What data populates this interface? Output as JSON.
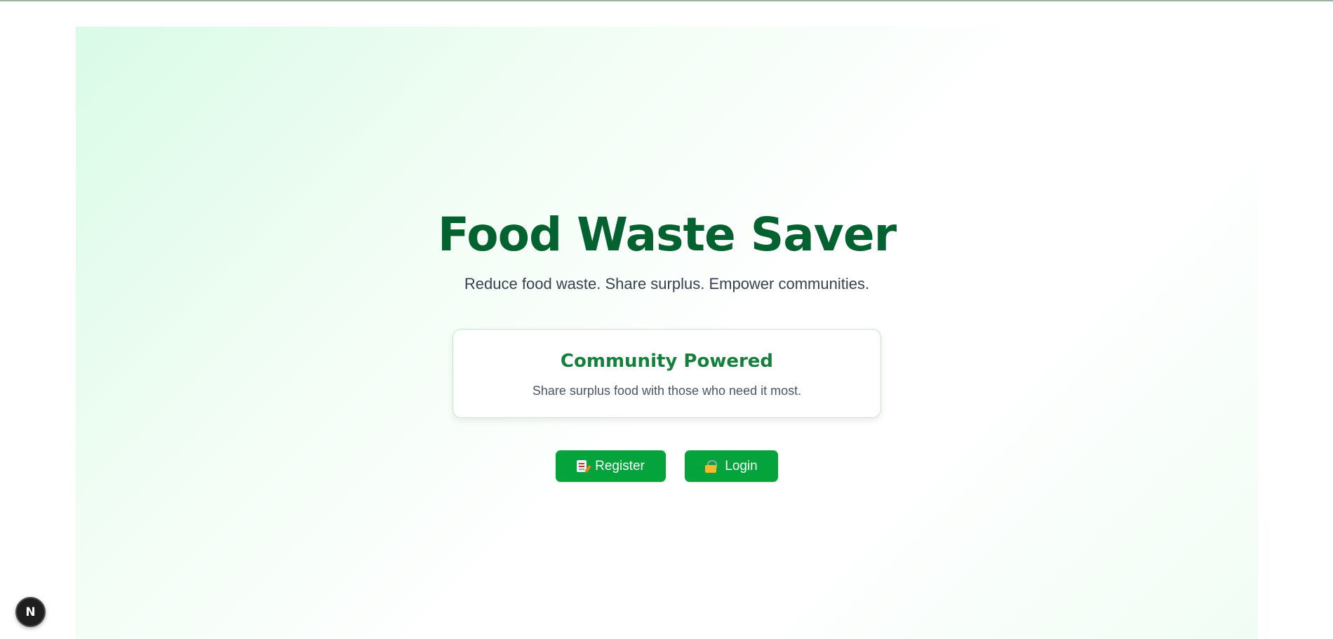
{
  "hero": {
    "title": "Food Waste Saver",
    "subtitle": "Reduce food waste. Share surplus. Empower communities."
  },
  "card": {
    "title": "Community Powered",
    "text": "Share surplus food with those who need it most."
  },
  "actions": {
    "register_label": "Register",
    "register_icon": "memo-icon",
    "login_label": "Login",
    "login_icon": "lock-icon"
  },
  "dev_badge": {
    "letter": "N",
    "icon": "nextjs-logo-icon"
  },
  "colors": {
    "title_green": "#03622f",
    "card_title_green": "#14803c",
    "button_green": "#04a33b",
    "hero_gradient_start": "#d9fbe6"
  }
}
